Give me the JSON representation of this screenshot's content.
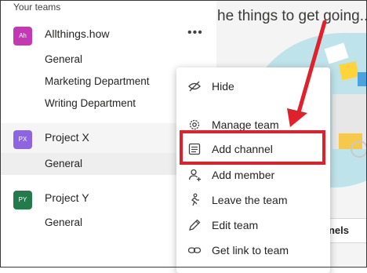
{
  "sidebar": {
    "section_title": "Your teams",
    "teams": [
      {
        "initials": "Ah",
        "name": "Allthings.how",
        "color": "#c239b3",
        "more": "•••",
        "channels": [
          "General",
          "Marketing Department",
          "Writing Department"
        ]
      },
      {
        "initials": "PX",
        "name": "Project X",
        "color": "#8e65e0",
        "channels": [
          "General"
        ]
      },
      {
        "initials": "PY",
        "name": "Project Y",
        "color": "#237b4b",
        "channels": [
          "General"
        ]
      }
    ]
  },
  "main": {
    "heading": "he things to get going...",
    "channels_button": "nnels"
  },
  "context_menu": {
    "items": [
      {
        "label": "Hide",
        "icon": "hide-icon"
      },
      {
        "label": "Manage team",
        "icon": "gear-icon"
      },
      {
        "label": "Add channel",
        "icon": "add-channel-icon"
      },
      {
        "label": "Add member",
        "icon": "add-member-icon"
      },
      {
        "label": "Leave the team",
        "icon": "leave-team-icon"
      },
      {
        "label": "Edit team",
        "icon": "pencil-icon"
      },
      {
        "label": "Get link to team",
        "icon": "link-icon"
      }
    ]
  },
  "annotation": {
    "highlight_color": "#e0202a"
  }
}
